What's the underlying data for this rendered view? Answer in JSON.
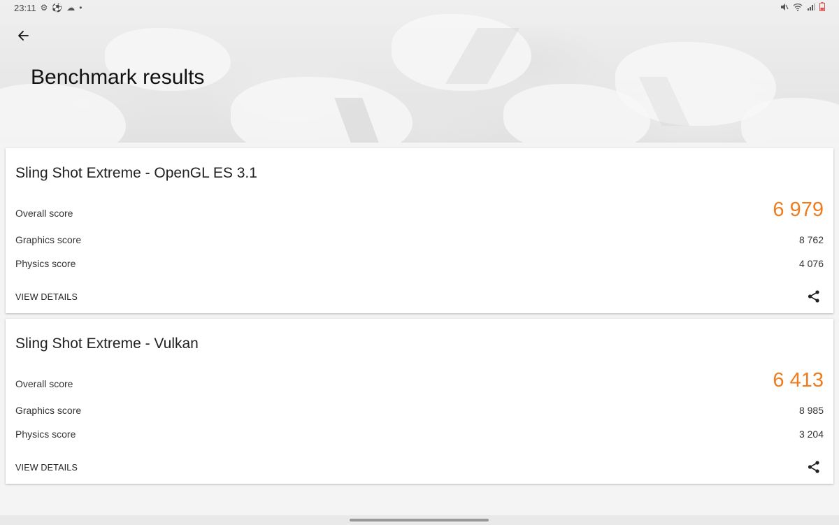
{
  "status_bar": {
    "time": "23:11",
    "left_icons": [
      "gear-icon",
      "soccer-ball-icon",
      "cloud-icon",
      "dot-icon"
    ],
    "right_icons": [
      "mute-icon",
      "wifi-icon",
      "signal-icon",
      "battery-icon"
    ]
  },
  "header": {
    "back_icon": "arrow-left-icon",
    "title": "Benchmark results"
  },
  "results": [
    {
      "title": "Sling Shot Extreme - OpenGL ES 3.1",
      "overall_label": "Overall score",
      "overall_value": "6 979",
      "graphics_label": "Graphics score",
      "graphics_value": "8 762",
      "physics_label": "Physics score",
      "physics_value": "4 076",
      "view_details": "VIEW DETAILS",
      "share_icon": "share-icon"
    },
    {
      "title": "Sling Shot Extreme - Vulkan",
      "overall_label": "Overall score",
      "overall_value": "6 413",
      "graphics_label": "Graphics score",
      "graphics_value": "8 985",
      "physics_label": "Physics score",
      "physics_value": "3 204",
      "view_details": "VIEW DETAILS",
      "share_icon": "share-icon"
    }
  ],
  "colors": {
    "accent_score": "#ee7d1f",
    "card_background": "#ffffff",
    "page_background": "#f4f4f4"
  }
}
